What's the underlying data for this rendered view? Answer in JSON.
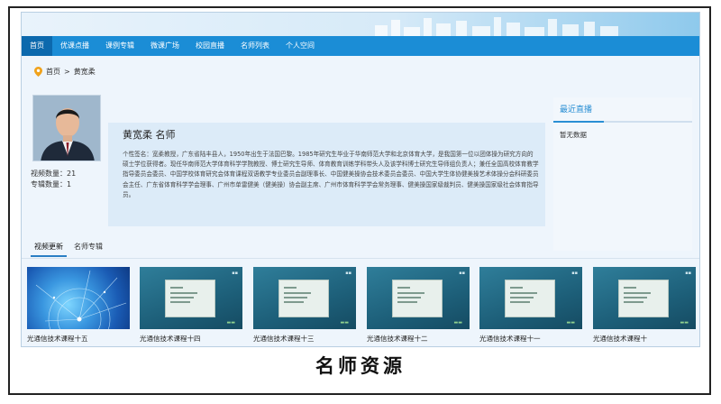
{
  "nav": {
    "items": [
      "首页",
      "优课点播",
      "课例专辑",
      "微课广场",
      "校园直播",
      "名师列表",
      "个人空间"
    ],
    "active_index": 0
  },
  "breadcrumb": {
    "home": "首页",
    "separator": ">",
    "current": "黄宽柔"
  },
  "profile": {
    "name": "黄宽柔 名师",
    "video_count": "视频数量：21",
    "album_count": "专辑数量：1",
    "bio": "个性签名：宽柔教授，广东省陆丰县人，1950年出生于法国巴黎。1985年研究生毕业于华南师范大学和北京体育大学，是我国第一位以团体操为研究方向的硕士学位获得者。现任华南师范大学体育科学学院教授、博士研究生导师、体育教育训练学科带头人及该学科博士研究生导师组负责人；兼任全国高校体育教学指导委员会委员、中国学校体育研究会体育课程双语教学专业委员会副理事长、中国健美操协会技术委员会委员、中国大学生体协健美操艺术体操分会科研委员会主任、广东省体育科学学会理事、广州市单雷健美（健美操）协会副主席、广州市体育科学学会常务理事、健美操国家级裁判员、健美操国家级社会体育指导员。"
  },
  "live": {
    "title": "最近直播",
    "empty_text": "暂无数据"
  },
  "tabs": [
    "视频更新",
    "名师专辑"
  ],
  "videos": [
    {
      "title": "光通信技术课程十五"
    },
    {
      "title": "光通信技术课程十四"
    },
    {
      "title": "光通信技术课程十三"
    },
    {
      "title": "光通信技术课程十二"
    },
    {
      "title": "光通信技术课程十一"
    },
    {
      "title": "光通信技术课程十"
    }
  ],
  "caption": "名师资源",
  "colors": {
    "nav": "#1b8dd6",
    "nav_active": "#0c69ad",
    "accent": "#2a8fd4"
  }
}
